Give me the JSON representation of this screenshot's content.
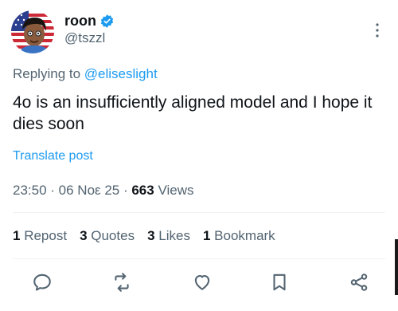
{
  "author": {
    "display_name": "roon",
    "handle": "@tszzl"
  },
  "reply": {
    "prefix": "Replying to ",
    "target": "@eliseslight"
  },
  "post": {
    "text": "4o is an insufficiently aligned model and I hope it dies soon",
    "translate_label": "Translate post"
  },
  "meta": {
    "time": "23:50",
    "sep1": " · ",
    "date": "06 Νοε 25",
    "sep2": " · ",
    "views_count": "663",
    "views_label": " Views"
  },
  "stats": {
    "reposts_count": "1",
    "reposts_label": " Repost",
    "quotes_count": "3",
    "quotes_label": " Quotes",
    "likes_count": "3",
    "likes_label": " Likes",
    "bookmarks_count": "1",
    "bookmarks_label": " Bookmark"
  },
  "icons": {
    "verified": "verified-badge-icon",
    "more": "more-vertical-icon",
    "reply": "reply-icon",
    "repost": "repost-icon",
    "like": "heart-icon",
    "bookmark": "bookmark-icon",
    "share": "share-icon"
  },
  "colors": {
    "accent": "#1d9bf0",
    "secondary_text": "#536471",
    "primary_text": "#0f1419"
  }
}
